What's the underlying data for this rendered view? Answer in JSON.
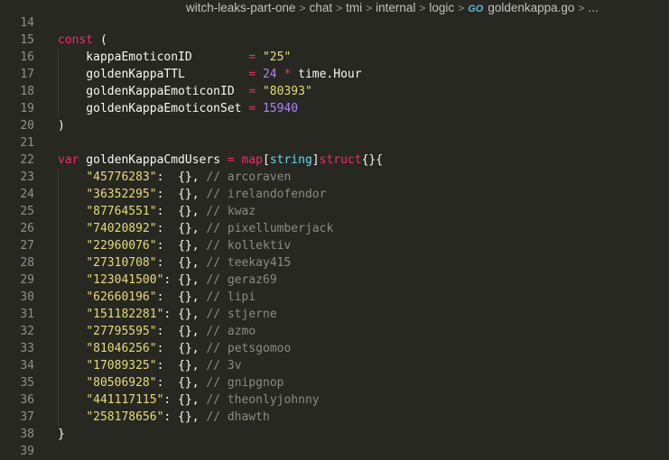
{
  "breadcrumb": {
    "items": [
      "witch-leaks-part-one",
      "chat",
      "tmi",
      "internal",
      "logic"
    ],
    "file_icon": "GO",
    "file": "goldenkappa.go",
    "more": "..."
  },
  "editor": {
    "lines": [
      {
        "n": 14,
        "indent": false,
        "tokens": []
      },
      {
        "n": 15,
        "indent": false,
        "tokens": [
          {
            "t": "const",
            "c": "kw"
          },
          {
            "t": " (",
            "c": "pun"
          }
        ]
      },
      {
        "n": 16,
        "indent": true,
        "tokens": [
          {
            "t": "    kappaEmoticonID        ",
            "c": "pun"
          },
          {
            "t": "=",
            "c": "op"
          },
          {
            "t": " ",
            "c": "pun"
          },
          {
            "t": "\"25\"",
            "c": "str"
          }
        ]
      },
      {
        "n": 17,
        "indent": true,
        "tokens": [
          {
            "t": "    goldenKappaTTL         ",
            "c": "pun"
          },
          {
            "t": "=",
            "c": "op"
          },
          {
            "t": " ",
            "c": "pun"
          },
          {
            "t": "24",
            "c": "num"
          },
          {
            "t": " ",
            "c": "pun"
          },
          {
            "t": "*",
            "c": "op"
          },
          {
            "t": " time.Hour",
            "c": "pun"
          }
        ]
      },
      {
        "n": 18,
        "indent": true,
        "tokens": [
          {
            "t": "    goldenKappaEmoticonID  ",
            "c": "pun"
          },
          {
            "t": "=",
            "c": "op"
          },
          {
            "t": " ",
            "c": "pun"
          },
          {
            "t": "\"80393\"",
            "c": "str"
          }
        ]
      },
      {
        "n": 19,
        "indent": true,
        "tokens": [
          {
            "t": "    goldenKappaEmoticonSet ",
            "c": "pun"
          },
          {
            "t": "=",
            "c": "op"
          },
          {
            "t": " ",
            "c": "pun"
          },
          {
            "t": "15940",
            "c": "num"
          }
        ]
      },
      {
        "n": 20,
        "indent": false,
        "tokens": [
          {
            "t": ")",
            "c": "pun"
          }
        ]
      },
      {
        "n": 21,
        "indent": false,
        "tokens": []
      },
      {
        "n": 22,
        "indent": false,
        "tokens": [
          {
            "t": "var",
            "c": "kw"
          },
          {
            "t": " goldenKappaCmdUsers ",
            "c": "pun"
          },
          {
            "t": "=",
            "c": "op"
          },
          {
            "t": " ",
            "c": "pun"
          },
          {
            "t": "map",
            "c": "kw"
          },
          {
            "t": "[",
            "c": "pun"
          },
          {
            "t": "string",
            "c": "fn"
          },
          {
            "t": "]",
            "c": "pun"
          },
          {
            "t": "struct",
            "c": "kw"
          },
          {
            "t": "{}{",
            "c": "pun"
          }
        ]
      },
      {
        "n": 23,
        "indent": true,
        "tokens": [
          {
            "t": "    ",
            "c": "pun"
          },
          {
            "t": "\"45776283\"",
            "c": "str"
          },
          {
            "t": ":  {}, ",
            "c": "pun"
          },
          {
            "t": "// arcoraven",
            "c": "cm"
          }
        ]
      },
      {
        "n": 24,
        "indent": true,
        "tokens": [
          {
            "t": "    ",
            "c": "pun"
          },
          {
            "t": "\"36352295\"",
            "c": "str"
          },
          {
            "t": ":  {}, ",
            "c": "pun"
          },
          {
            "t": "// irelandofendor",
            "c": "cm"
          }
        ]
      },
      {
        "n": 25,
        "indent": true,
        "tokens": [
          {
            "t": "    ",
            "c": "pun"
          },
          {
            "t": "\"87764551\"",
            "c": "str"
          },
          {
            "t": ":  {}, ",
            "c": "pun"
          },
          {
            "t": "// kwaz",
            "c": "cm"
          }
        ]
      },
      {
        "n": 26,
        "indent": true,
        "tokens": [
          {
            "t": "    ",
            "c": "pun"
          },
          {
            "t": "\"74020892\"",
            "c": "str"
          },
          {
            "t": ":  {}, ",
            "c": "pun"
          },
          {
            "t": "// pixellumberjack",
            "c": "cm"
          }
        ]
      },
      {
        "n": 27,
        "indent": true,
        "tokens": [
          {
            "t": "    ",
            "c": "pun"
          },
          {
            "t": "\"22960076\"",
            "c": "str"
          },
          {
            "t": ":  {}, ",
            "c": "pun"
          },
          {
            "t": "// kollektiv",
            "c": "cm"
          }
        ]
      },
      {
        "n": 28,
        "indent": true,
        "tokens": [
          {
            "t": "    ",
            "c": "pun"
          },
          {
            "t": "\"27310708\"",
            "c": "str"
          },
          {
            "t": ":  {}, ",
            "c": "pun"
          },
          {
            "t": "// teekay415",
            "c": "cm"
          }
        ]
      },
      {
        "n": 29,
        "indent": true,
        "tokens": [
          {
            "t": "    ",
            "c": "pun"
          },
          {
            "t": "\"123041500\"",
            "c": "str"
          },
          {
            "t": ": {}, ",
            "c": "pun"
          },
          {
            "t": "// geraz69",
            "c": "cm"
          }
        ]
      },
      {
        "n": 30,
        "indent": true,
        "tokens": [
          {
            "t": "    ",
            "c": "pun"
          },
          {
            "t": "\"62660196\"",
            "c": "str"
          },
          {
            "t": ":  {}, ",
            "c": "pun"
          },
          {
            "t": "// lipi",
            "c": "cm"
          }
        ]
      },
      {
        "n": 31,
        "indent": true,
        "tokens": [
          {
            "t": "    ",
            "c": "pun"
          },
          {
            "t": "\"151182281\"",
            "c": "str"
          },
          {
            "t": ": {}, ",
            "c": "pun"
          },
          {
            "t": "// stjerne",
            "c": "cm"
          }
        ]
      },
      {
        "n": 32,
        "indent": true,
        "tokens": [
          {
            "t": "    ",
            "c": "pun"
          },
          {
            "t": "\"27795595\"",
            "c": "str"
          },
          {
            "t": ":  {}, ",
            "c": "pun"
          },
          {
            "t": "// azmo",
            "c": "cm"
          }
        ]
      },
      {
        "n": 33,
        "indent": true,
        "tokens": [
          {
            "t": "    ",
            "c": "pun"
          },
          {
            "t": "\"81046256\"",
            "c": "str"
          },
          {
            "t": ":  {}, ",
            "c": "pun"
          },
          {
            "t": "// petsgomoo",
            "c": "cm"
          }
        ]
      },
      {
        "n": 34,
        "indent": true,
        "tokens": [
          {
            "t": "    ",
            "c": "pun"
          },
          {
            "t": "\"17089325\"",
            "c": "str"
          },
          {
            "t": ":  {}, ",
            "c": "pun"
          },
          {
            "t": "// 3v",
            "c": "cm"
          }
        ]
      },
      {
        "n": 35,
        "indent": true,
        "tokens": [
          {
            "t": "    ",
            "c": "pun"
          },
          {
            "t": "\"80506928\"",
            "c": "str"
          },
          {
            "t": ":  {}, ",
            "c": "pun"
          },
          {
            "t": "// gnipgnop",
            "c": "cm"
          }
        ]
      },
      {
        "n": 36,
        "indent": true,
        "tokens": [
          {
            "t": "    ",
            "c": "pun"
          },
          {
            "t": "\"441117115\"",
            "c": "str"
          },
          {
            "t": ": {}, ",
            "c": "pun"
          },
          {
            "t": "// theonlyjohnny",
            "c": "cm"
          }
        ]
      },
      {
        "n": 37,
        "indent": true,
        "tokens": [
          {
            "t": "    ",
            "c": "pun"
          },
          {
            "t": "\"258178656\"",
            "c": "str"
          },
          {
            "t": ": {}, ",
            "c": "pun"
          },
          {
            "t": "// dhawth",
            "c": "cm"
          }
        ]
      },
      {
        "n": 38,
        "indent": false,
        "tokens": [
          {
            "t": "}",
            "c": "pun"
          }
        ]
      },
      {
        "n": 39,
        "indent": false,
        "tokens": []
      }
    ]
  },
  "colors": {
    "background": "#272822",
    "keyword": "#f92672",
    "type": "#66d9ef",
    "string": "#e6db74",
    "number": "#ae81ff",
    "comment": "#8d8b7e",
    "text": "#f8f8f2",
    "line_number": "#8f908a"
  }
}
